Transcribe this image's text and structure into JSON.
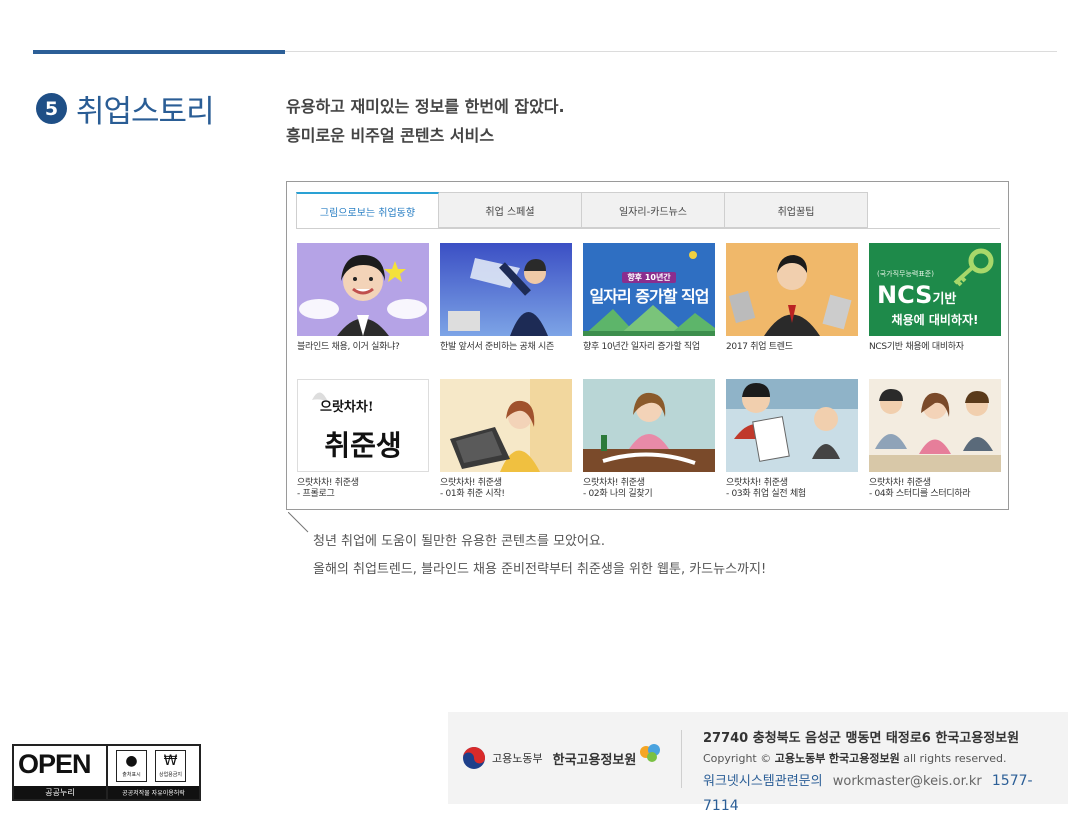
{
  "section": {
    "number": "5",
    "title": "취업스토리"
  },
  "intro": {
    "line1": "유용하고 재미있는 정보를 한번에 잡았다.",
    "line2": "흥미로운 비주얼 콘텐츠 서비스"
  },
  "tabs": [
    {
      "label": "그림으로보는 취업동향",
      "active": true
    },
    {
      "label": "취업 스페셜",
      "active": false
    },
    {
      "label": "일자리-카드뉴스",
      "active": false
    },
    {
      "label": "취업꿀팁",
      "active": false
    }
  ],
  "cards": [
    {
      "line1": "블라인드 채용, 이거 실화냐?",
      "line2": ""
    },
    {
      "line1": "한발 앞서서 준비하는 공채 시즌",
      "line2": ""
    },
    {
      "line1": "향후 10년간 일자리 증가할 직업",
      "line2": ""
    },
    {
      "line1": "2017 취업 트렌드",
      "line2": ""
    },
    {
      "line1": "NCS기반 채용에 대비하자",
      "line2": ""
    },
    {
      "line1": "으랏차차! 취준생",
      "line2": "- 프롤로그"
    },
    {
      "line1": "으랏차차! 취준생",
      "line2": "- 01화 취준 시작!"
    },
    {
      "line1": "으랏차차! 취준생",
      "line2": "- 02화 나의 길찾기"
    },
    {
      "line1": "으랏차차! 취준생",
      "line2": "- 03화 취업 실전 체험"
    },
    {
      "line1": "으랏차차! 취준생",
      "line2": "- 04화 스터디를 스터디하라"
    }
  ],
  "thumb_text": {
    "card3_badge": "향후 10년간",
    "card3_title": "일자리 증가할 직업",
    "card5_small": "(국가직무능력표준)",
    "card5_big": "NCS",
    "card5_suffix": "기반",
    "card5_line2": "채용에 대비하자!",
    "card6_top": "으랏차차!",
    "card6_big": "취준생"
  },
  "description": {
    "line1": "청년 취업에 도움이 될만한 유용한 콘텐츠를 모았어요.",
    "line2": "올해의 취업트렌드, 블라인드 채용 준비전략부터 취준생을 위한 웹툰, 카드뉴스까지!"
  },
  "open_license": {
    "word": "OPEN",
    "sub": "공공누리",
    "icon1": "출처표시",
    "icon2": "상업용금지",
    "sub2": "공공저작물 자유이용허락"
  },
  "footer": {
    "ministry": "고용노동부",
    "org": "한국고용정보원",
    "address": "27740 충청북도 음성군 맹동면 태정로6 한국고용정보원",
    "copyright_prefix": "Copyright ©",
    "copyright_ministry": "고용노동부",
    "copyright_org": "한국고용정보원",
    "copyright_suffix": "all rights reserved.",
    "contact_label": "워크넷시스템관련문의",
    "email": "workmaster@keis.or.kr",
    "phone": "1577-7114"
  },
  "colors": {
    "accent": "#2c5f97",
    "tab_active": "#2aa1d4"
  }
}
